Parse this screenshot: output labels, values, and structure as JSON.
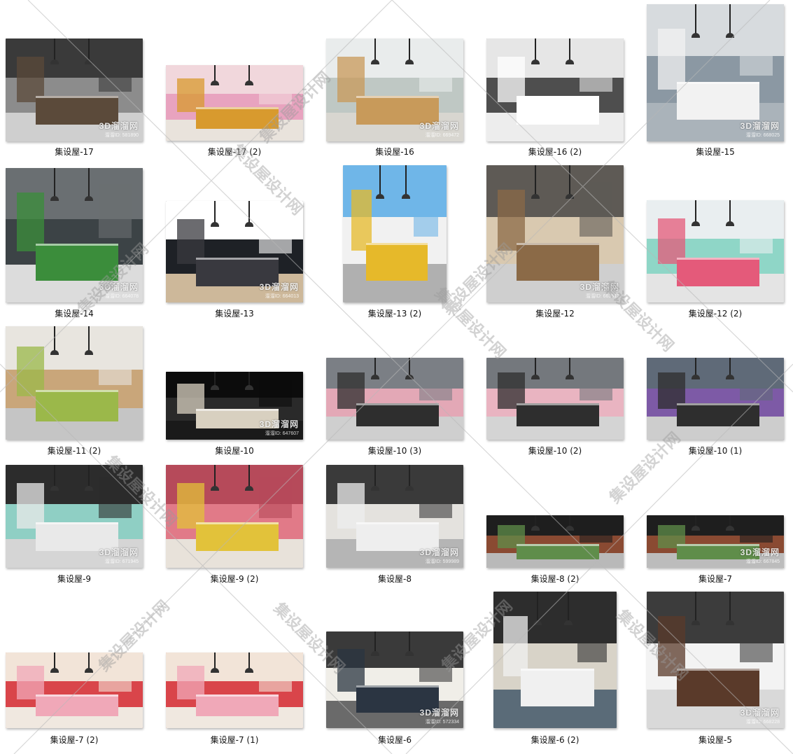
{
  "watermark": {
    "text": "集设屋设计网"
  },
  "thumb_watermark": "3D溜溜网",
  "items": [
    {
      "label": "集设屋-17",
      "id_text": "溜溜ID: 581890",
      "colors": [
        "#3a3a3a",
        "#8c8c8c",
        "#cfcfcf",
        "#5b4a3a"
      ]
    },
    {
      "label": "集设屋-17 (2)",
      "id_text": "",
      "colors": [
        "#f1d7dc",
        "#e8a3bf",
        "#e9e3dc",
        "#d89a2e"
      ]
    },
    {
      "label": "集设屋-16",
      "id_text": "溜溜ID: 669472",
      "colors": [
        "#e9ecec",
        "#bfc8c4",
        "#d8d6d0",
        "#c89a5a"
      ]
    },
    {
      "label": "集设屋-16 (2)",
      "id_text": "",
      "colors": [
        "#e6e6e6",
        "#4e4e4e",
        "#ededed",
        "#ffffff"
      ]
    },
    {
      "label": "集设屋-15",
      "id_text": "溜溜ID: 668025",
      "colors": [
        "#d7dbde",
        "#8b98a3",
        "#aab3ba",
        "#f2f2f2"
      ]
    },
    {
      "label": "集设屋-14",
      "id_text": "溜溜ID: 664078",
      "colors": [
        "#6a6f72",
        "#3c4346",
        "#dcdcdc",
        "#3b8d3b"
      ]
    },
    {
      "label": "集设屋-13",
      "id_text": "溜溜ID: 664013",
      "colors": [
        "#ffffff",
        "#1e2126",
        "#cdb89a",
        "#39393f"
      ]
    },
    {
      "label": "集设屋-13 (2)",
      "id_text": "",
      "colors": [
        "#6fb6e8",
        "#f1f1f1",
        "#b0b0b0",
        "#e6b92a"
      ]
    },
    {
      "label": "集设屋-12",
      "id_text": "溜溜ID: 663512",
      "colors": [
        "#5e5a55",
        "#d9c9b0",
        "#cfcfcf",
        "#8b6a47"
      ]
    },
    {
      "label": "集设屋-12 (2)",
      "id_text": "",
      "colors": [
        "#e9eef0",
        "#8fd6c7",
        "#e4e4e4",
        "#e45a7a"
      ]
    },
    {
      "label": "集设屋-11 (2)",
      "id_text": "",
      "colors": [
        "#e8e5df",
        "#c9a67a",
        "#c5c5c5",
        "#9bb84a"
      ]
    },
    {
      "label": "集设屋-10",
      "id_text": "溜溜ID: 647607",
      "colors": [
        "#0c0c0c",
        "#2a2a2a",
        "#1a1a1a",
        "#d8d0c0"
      ]
    },
    {
      "label": "集设屋-10 (3)",
      "id_text": "",
      "colors": [
        "#7b7f85",
        "#e3a8b6",
        "#cfcfcf",
        "#2e2e2e"
      ]
    },
    {
      "label": "集设屋-10 (2)",
      "id_text": "",
      "colors": [
        "#74787d",
        "#e9b4c1",
        "#d4d4d4",
        "#2e2e2e"
      ]
    },
    {
      "label": "集设屋-10 (1)",
      "id_text": "",
      "colors": [
        "#5f6a78",
        "#7d5aa6",
        "#cdcdcd",
        "#2e2e2e"
      ]
    },
    {
      "label": "集设屋-9",
      "id_text": "溜溜ID: 671945",
      "colors": [
        "#2c2c2c",
        "#8fcfc4",
        "#d5d5d5",
        "#e9e9e9"
      ]
    },
    {
      "label": "集设屋-9 (2)",
      "id_text": "",
      "colors": [
        "#b64a5a",
        "#e17a88",
        "#e8e2da",
        "#e2c23a"
      ]
    },
    {
      "label": "集设屋-8",
      "id_text": "溜溜ID: 599989",
      "colors": [
        "#3a3a3a",
        "#e4e2de",
        "#b5b5b5",
        "#eeeeee"
      ]
    },
    {
      "label": "集设屋-8 (2)",
      "id_text": "",
      "colors": [
        "#1e1e1e",
        "#8a4a32",
        "#b9b9b9",
        "#5f8d4a"
      ]
    },
    {
      "label": "集设屋-7",
      "id_text": "溜溜ID: 667845",
      "colors": [
        "#1e1e1e",
        "#8a4a32",
        "#bcbcbc",
        "#5f8d4a"
      ]
    },
    {
      "label": "集设屋-7 (2)",
      "id_text": "",
      "colors": [
        "#f2e4d8",
        "#d9454a",
        "#f0e8e0",
        "#f0a8b8"
      ]
    },
    {
      "label": "集设屋-7 (1)",
      "id_text": "",
      "colors": [
        "#f2e4d8",
        "#d9454a",
        "#f0e8e0",
        "#f0a8b8"
      ]
    },
    {
      "label": "集设屋-6",
      "id_text": "溜溜ID: 572334",
      "colors": [
        "#3a3a3a",
        "#f0eee8",
        "#6a6a6a",
        "#2b3542"
      ]
    },
    {
      "label": "集设屋-6 (2)",
      "id_text": "",
      "colors": [
        "#2d2d2d",
        "#d8d3c8",
        "#5a6b78",
        "#f0f0f0"
      ]
    },
    {
      "label": "集设屋-5",
      "id_text": "溜溜ID: 668228",
      "colors": [
        "#3c3c3c",
        "#f3f3f3",
        "#d9d9d9",
        "#5a3a2a"
      ]
    }
  ]
}
